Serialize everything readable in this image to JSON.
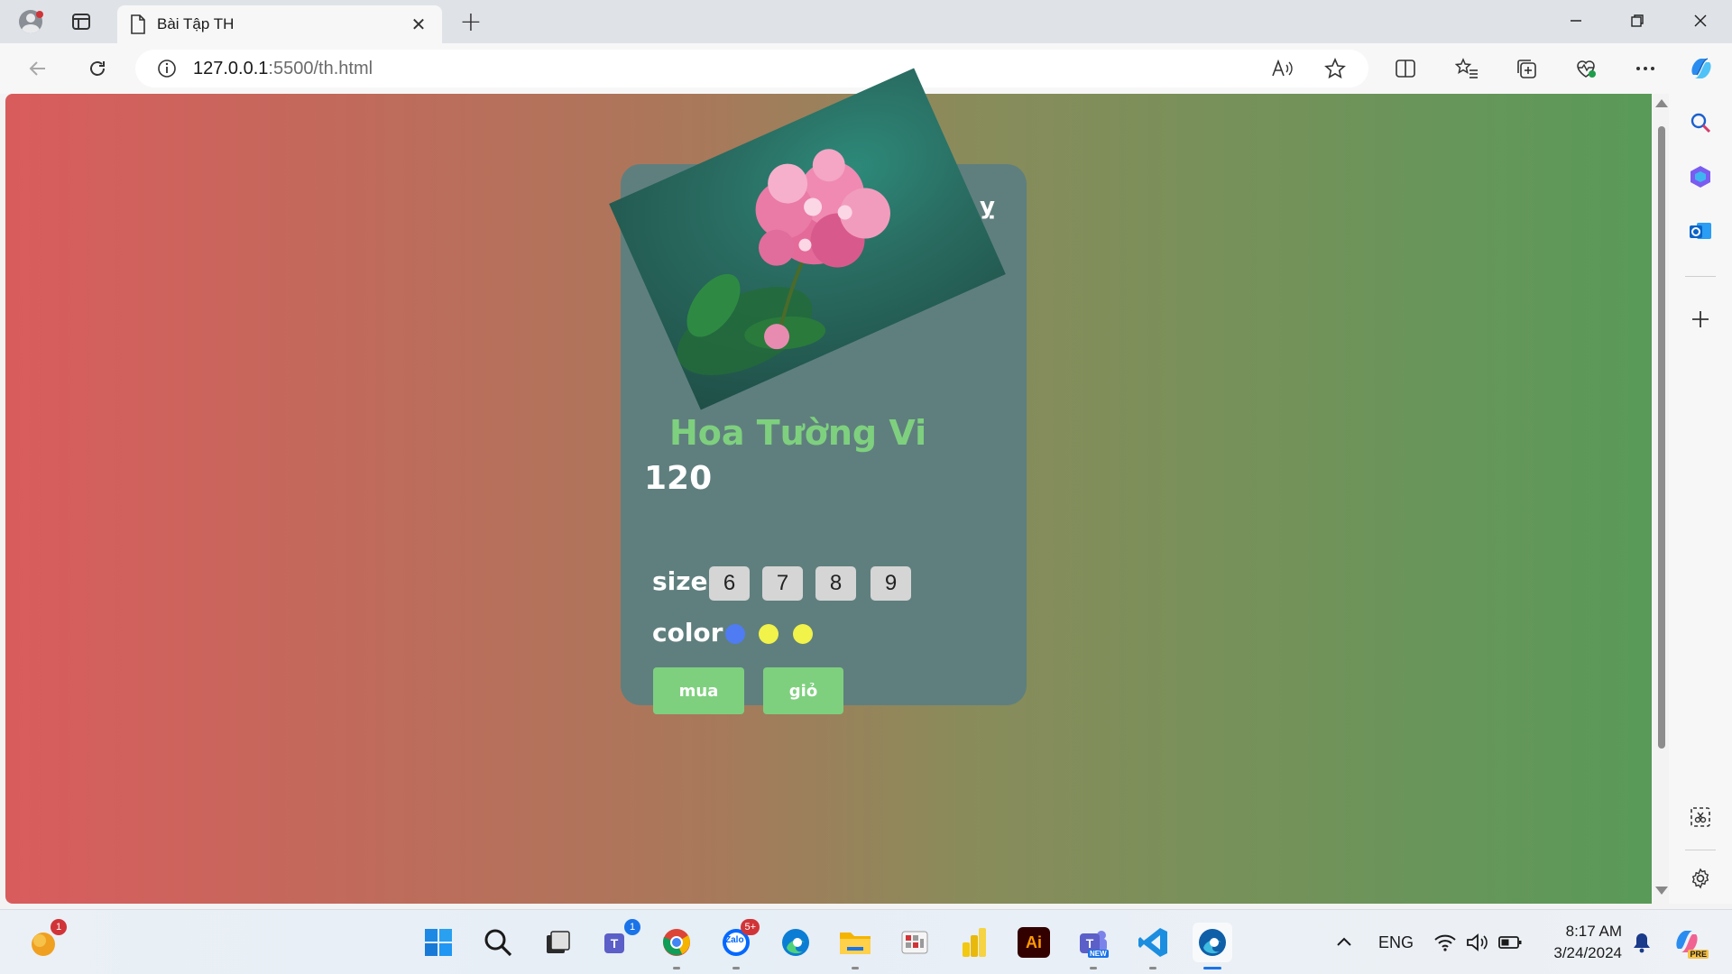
{
  "browser": {
    "tab_title": "Bài Tập TH",
    "tab_close": "✕",
    "new_tab": "+",
    "url_host": "127.0.0.1",
    "url_rest": ":5500/th.html"
  },
  "window_controls": {
    "minimize": "—",
    "restore": "❐",
    "close": "✕"
  },
  "page": {
    "card_glyph": "ỵ",
    "product_name": "Hoa Tường Vi",
    "price": "120",
    "size_label": "size",
    "sizes": [
      "6",
      "7",
      "8",
      "9"
    ],
    "color_label": "color",
    "colors": [
      "#4f7cf2",
      "#f1f24a",
      "#f1f24a"
    ],
    "buy_label": "mua",
    "cart_label": "giỏ"
  },
  "taskbar": {
    "notif_badge": "1",
    "teams_badge": "1",
    "zalo_badge": "5+",
    "zalo_label": "Zalo",
    "adobe_label": "Ai",
    "teams_new_label": "NEW",
    "pre_label": "PRE",
    "language": "ENG",
    "time": "8:17 AM",
    "date": "3/24/2024"
  },
  "theme": {
    "accent_green": "#7ed07e",
    "card_bg": "#5f7f7e"
  }
}
